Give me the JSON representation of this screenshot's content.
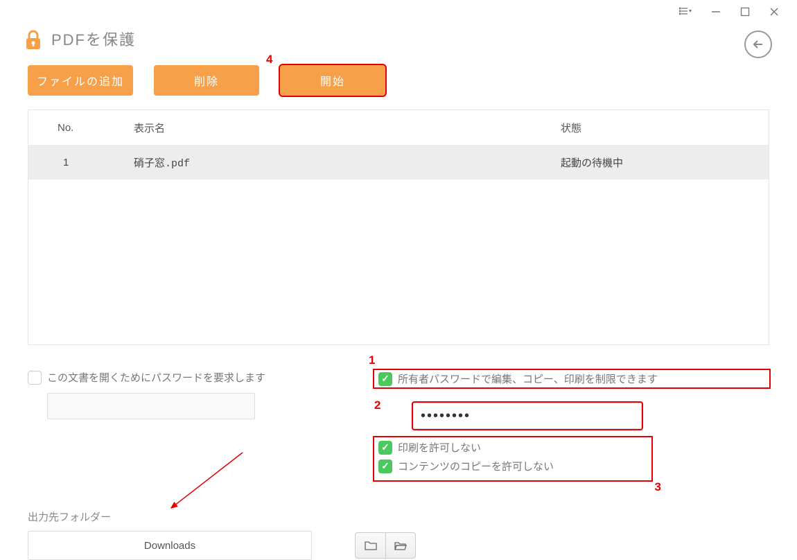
{
  "page_title": "PDFを保護",
  "toolbar": {
    "add_file": "ファイルの追加",
    "delete": "削除",
    "start": "開始"
  },
  "table": {
    "headers": {
      "no": "No.",
      "name": "表示名",
      "status": "状態"
    },
    "rows": [
      {
        "no": "1",
        "name": "硝子窓.pdf",
        "status": "起動の待機中"
      }
    ]
  },
  "options": {
    "open_password_label": "この文書を開くためにパスワードを要求します",
    "open_password_value": "",
    "owner_password_label": "所有者パスワードで編集、コピー、印刷を制限できます",
    "owner_password_value": "••••••••",
    "disallow_print_label": "印刷を許可しない",
    "disallow_copy_label": "コンテンツのコピーを許可しない"
  },
  "output": {
    "label": "出力先フォルダー",
    "path": "Downloads"
  },
  "annotations": {
    "n1": "1",
    "n2": "2",
    "n3": "3",
    "n4": "4"
  },
  "titlebar": {
    "min": "—",
    "max": "☐",
    "close": "✕"
  }
}
